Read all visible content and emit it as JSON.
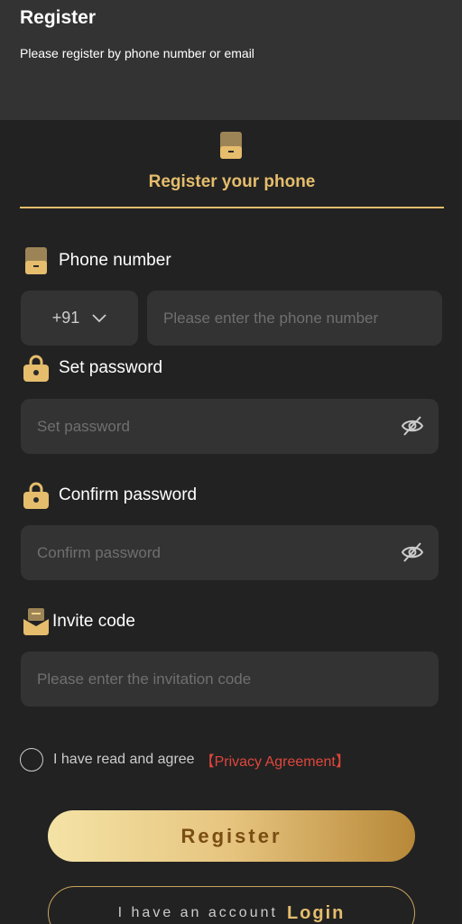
{
  "header": {
    "title": "Register",
    "subtitle": "Please register by phone number or email"
  },
  "tab": {
    "icon": "phone-icon",
    "label": "Register your phone"
  },
  "phone_field": {
    "label": "Phone number",
    "icon": "phone-icon",
    "country_code": "+91",
    "placeholder": "Please enter the phone number"
  },
  "password_field": {
    "label": "Set password",
    "icon": "lock-icon",
    "placeholder": "Set password"
  },
  "confirm_field": {
    "label": "Confirm password",
    "icon": "lock-icon",
    "placeholder": "Confirm password"
  },
  "invite_field": {
    "label": "Invite code",
    "icon": "invite-icon",
    "placeholder": "Please enter the invitation code"
  },
  "agreement": {
    "text": "I have read and agree",
    "link": "【Privacy Agreement】"
  },
  "buttons": {
    "register": "Register",
    "login_lead": "I have an account",
    "login": "Login"
  },
  "colors": {
    "background": "#222222",
    "panel": "#333333",
    "accent_gold": "#e5bd6c",
    "link_red": "#e0463c"
  }
}
